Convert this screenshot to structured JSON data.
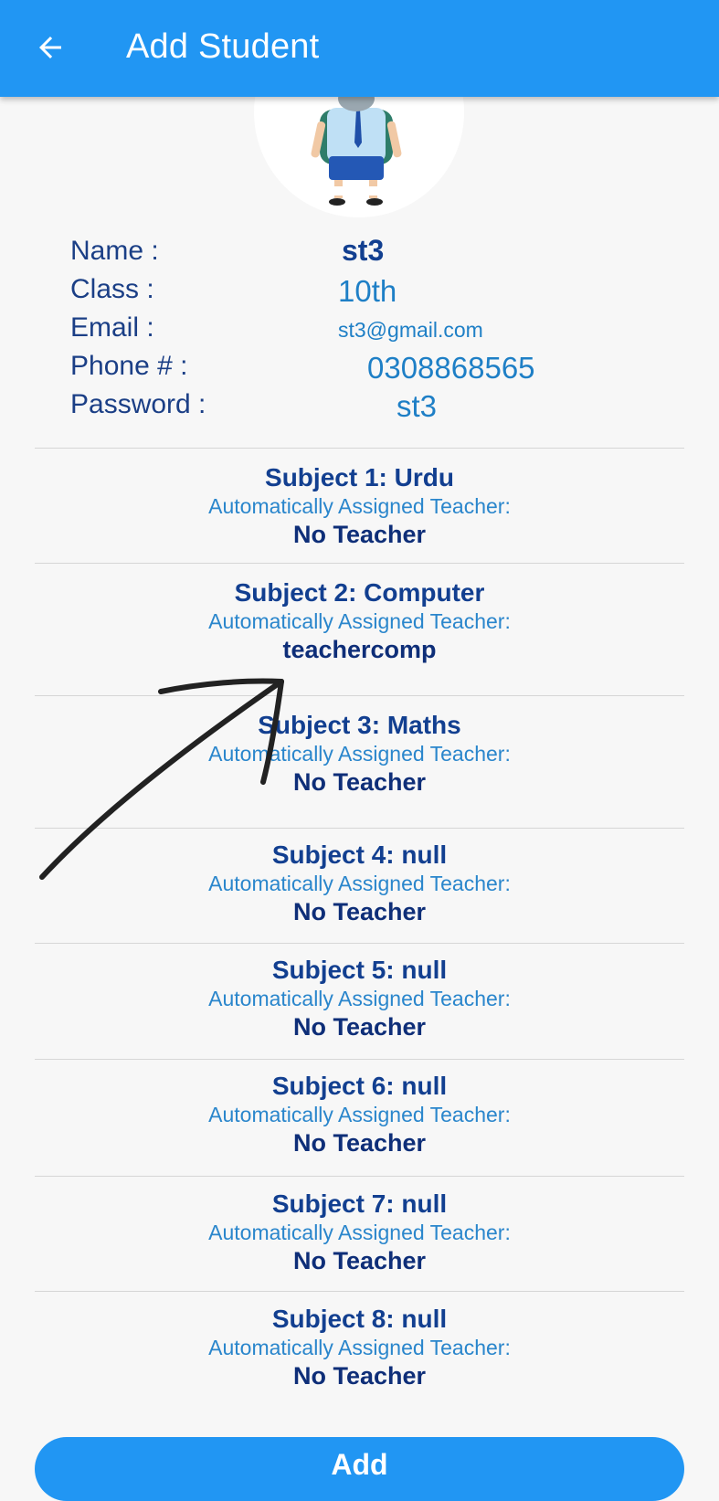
{
  "appbar": {
    "title": "Add Student",
    "back_icon": "arrow-left-icon"
  },
  "profile": {
    "avatar_icon": "student-illustration",
    "fields": [
      {
        "label": "Name :",
        "value": "st3"
      },
      {
        "label": "Class :",
        "value": "10th"
      },
      {
        "label": "Email :",
        "value": "st3@gmail.com"
      },
      {
        "label": "Phone # :",
        "value": "0308868565"
      },
      {
        "label": "Password :",
        "value": "st3"
      }
    ]
  },
  "subjects": [
    {
      "title": "Subject 1:  Urdu",
      "caption": "Automatically Assigned Teacher:",
      "teacher": "No Teacher"
    },
    {
      "title": "Subject 2:  Computer",
      "caption": "Automatically Assigned Teacher:",
      "teacher": "teachercomp"
    },
    {
      "title": "Subject 3:  Maths",
      "caption": "Automatically Assigned Teacher:",
      "teacher": "No Teacher"
    },
    {
      "title": "Subject 4:  null",
      "caption": "Automatically Assigned Teacher:",
      "teacher": "No Teacher"
    },
    {
      "title": "Subject 5:  null",
      "caption": "Automatically Assigned Teacher:",
      "teacher": "No Teacher"
    },
    {
      "title": "Subject 6:  null",
      "caption": "Automatically Assigned Teacher:",
      "teacher": "No Teacher"
    },
    {
      "title": "Subject 7:  null",
      "caption": "Automatically Assigned Teacher:",
      "teacher": "No Teacher"
    },
    {
      "title": "Subject 8:  null",
      "caption": "Automatically Assigned Teacher:",
      "teacher": "No Teacher"
    }
  ],
  "add_button": {
    "label": "Add"
  },
  "colors": {
    "appbar": "#2196f3",
    "label": "#1b3f86",
    "value": "#1e7fc6",
    "teacher": "#0e2e78"
  }
}
